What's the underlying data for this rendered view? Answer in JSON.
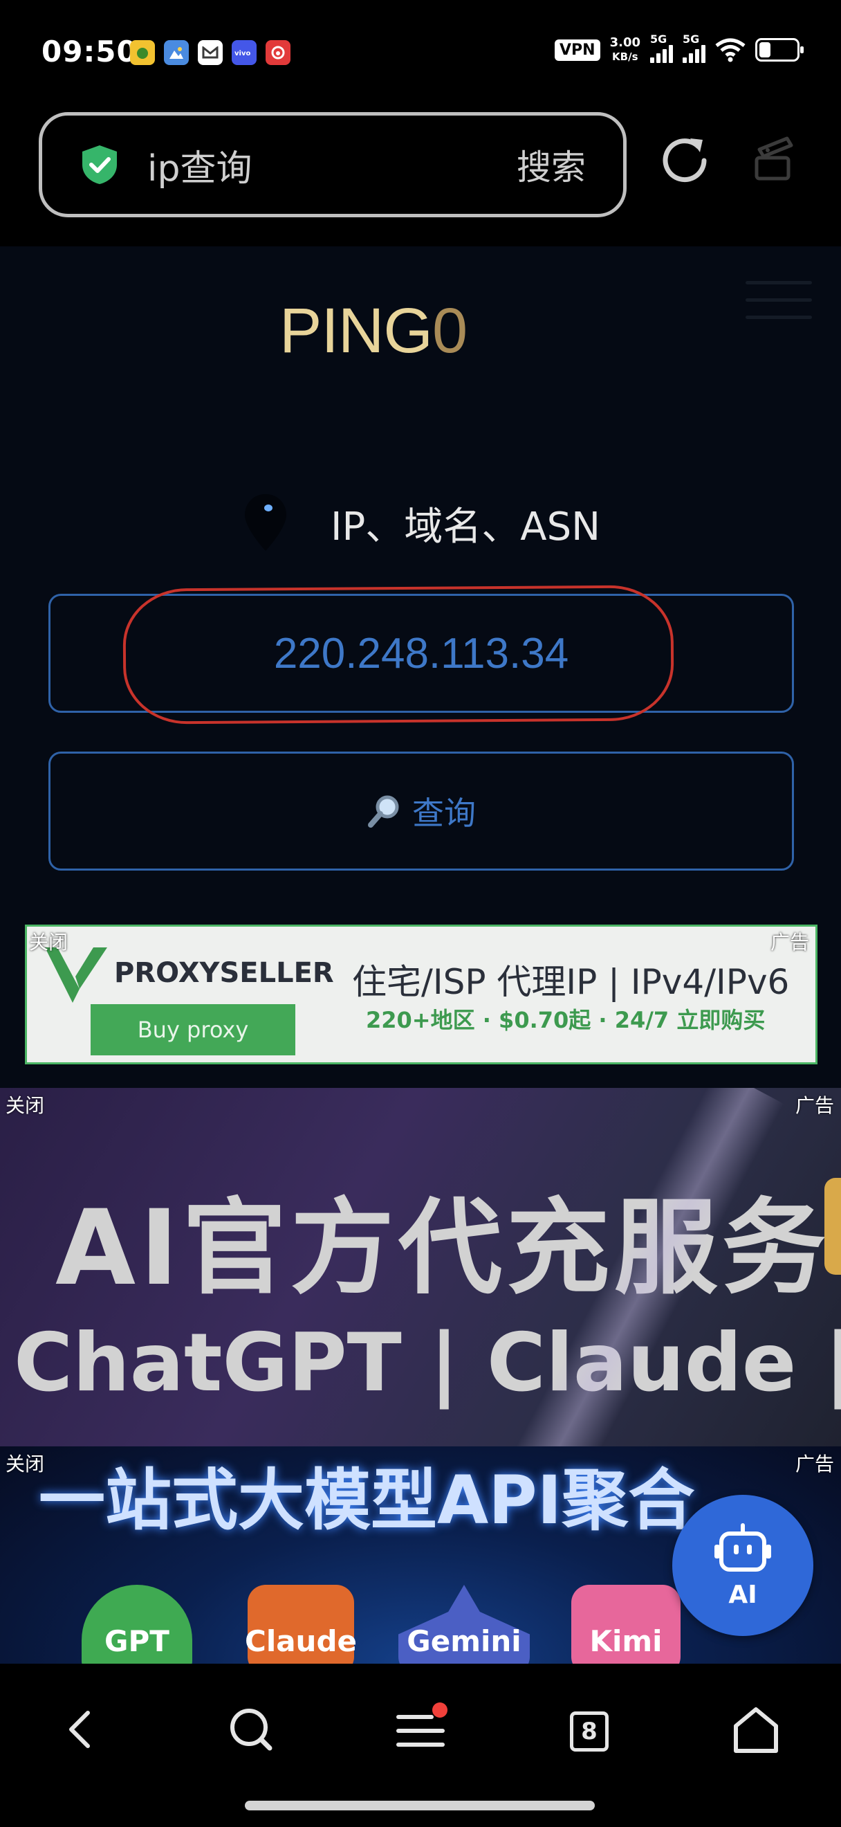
{
  "status_bar": {
    "time": "09:50",
    "notification_icons": [
      {
        "icon": "app-yellow-icon",
        "color": "#f2c230"
      },
      {
        "icon": "gallery-icon",
        "color": "#4a8be0"
      },
      {
        "icon": "gmail-icon",
        "color": "#ffffff"
      },
      {
        "icon": "vivo-icon",
        "color": "#4457e8"
      },
      {
        "icon": "netease-music-icon",
        "color": "#e23a3a"
      }
    ],
    "vpn": "VPN",
    "net_speed_value": "3.00",
    "net_speed_unit": "KB/s",
    "signal1_label": "5G",
    "signal2_label": "5G"
  },
  "browser": {
    "search_query": "ip查询",
    "search_button": "搜索"
  },
  "page": {
    "logo_part1": "PING",
    "logo_part2": "0",
    "query_label": "IP、域名、ASN",
    "ip_value": "220.248.113.34",
    "query_button": "查询"
  },
  "ads": [
    {
      "close": "关闭",
      "tag": "广告",
      "brand": "PROXYSELLER",
      "slogan": "住宅/ISP 代理IP | IPv4/IPv6",
      "subline": "220+地区 · $0.70起 · 24/7 立即购买",
      "cta": "Buy proxy"
    },
    {
      "close": "关闭",
      "tag": "广告",
      "headline": "AI官方代充服务",
      "subline": "ChatGPT | Claude | C"
    },
    {
      "close": "关闭",
      "tag": "广告",
      "headline": "一站式大模型API聚合",
      "models": [
        "GPT",
        "Claude",
        "Gemini",
        "Kimi"
      ]
    }
  ],
  "ai_fab": {
    "label": "AI"
  },
  "bottom_nav": {
    "tab_count": "8"
  },
  "colors": {
    "accent_blue": "#3e78c8",
    "logo_gold": "#e8d49a",
    "red_annotation": "#c8332b",
    "ad_green": "#43a857"
  }
}
